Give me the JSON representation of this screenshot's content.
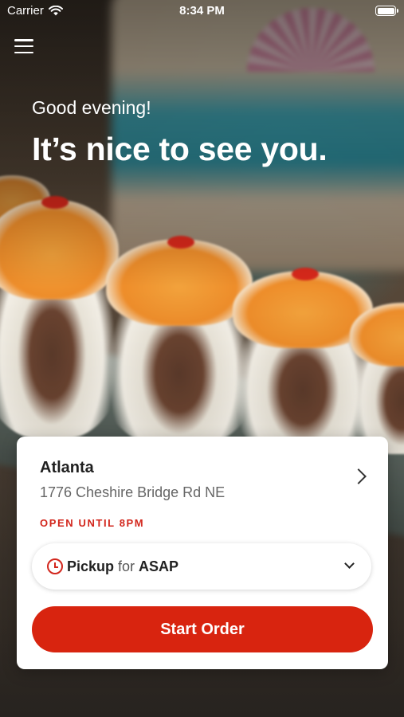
{
  "status_bar": {
    "carrier": "Carrier",
    "time": "8:34 PM",
    "wifi_icon": "wifi-icon",
    "battery_icon": "battery-icon"
  },
  "header": {
    "menu_icon": "hamburger-menu-icon"
  },
  "hero": {
    "greeting": "Good evening!",
    "headline": "It’s nice to see you."
  },
  "location_card": {
    "city": "Atlanta",
    "address": "1776 Cheshire Bridge Rd NE",
    "hours_status": "OPEN UNTIL 8PM",
    "chevron_icon": "chevron-right-icon"
  },
  "order_type": {
    "icon": "clock-icon",
    "mode": "Pickup",
    "connector": "for",
    "when": "ASAP",
    "dropdown_icon": "chevron-down-icon"
  },
  "cta": {
    "label": "Start Order"
  },
  "colors": {
    "accent": "#d8240f",
    "status_text": "#d2261c",
    "card_bg": "#ffffff"
  }
}
